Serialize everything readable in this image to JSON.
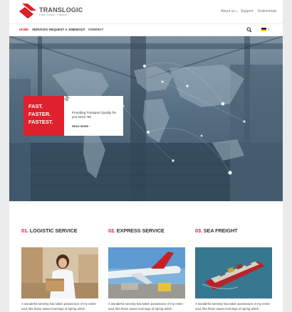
{
  "brand": {
    "name": "TRANSLOGIC",
    "tagline": "Fast. Faster. Fastest."
  },
  "utility_nav": {
    "about": "About us",
    "support": "Support",
    "testimonials": "Testimonials"
  },
  "main_nav": {
    "items": [
      "HOME",
      "SERVICES",
      "REQUEST A JOB",
      "ABOUT",
      "CONTACT"
    ],
    "active": "HOME"
  },
  "hero": {
    "red_lines": [
      "FAST.",
      "FASTER.",
      "FASTEST."
    ],
    "headline": "Providing Transport Quality for you since '89",
    "link": "READ MORE ›"
  },
  "services": [
    {
      "number": "01.",
      "title": "LOGISTIC SERVICE",
      "text": "A wonderful serenity has taken possession of my entire soul, like these sweet mornings of spring which",
      "image": "woman-with-box"
    },
    {
      "number": "02.",
      "title": "EXPRESS SERVICE",
      "text": "A wonderful serenity has taken possession of my entire soul, like these sweet mornings of spring which",
      "image": "cargo-plane"
    },
    {
      "number": "03.",
      "title": "SEA FREIGHT",
      "text": "A wonderful serenity has taken possession of my entire soul, like these sweet mornings of spring which",
      "image": "container-ship"
    }
  ],
  "icons": {
    "search": "search-icon",
    "language": "german-flag-icon",
    "dropdown": "chevron-down-icon"
  },
  "colors": {
    "accent": "#e0202c",
    "text": "#333333",
    "background": "#ebebeb"
  }
}
